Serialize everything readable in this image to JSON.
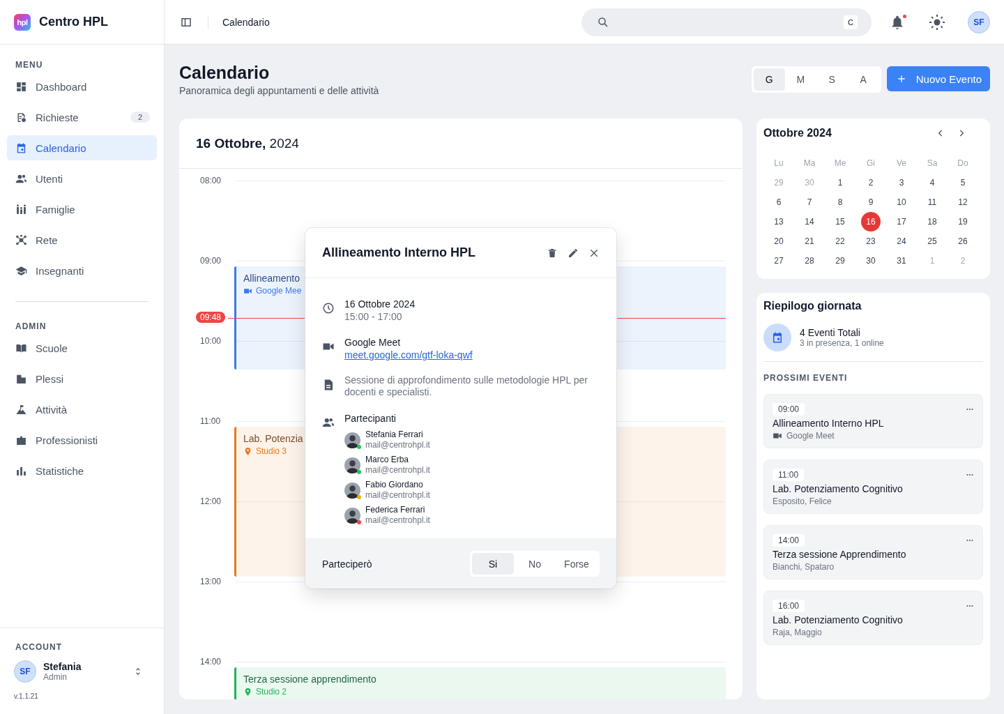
{
  "brand": {
    "logo_text": "hpl",
    "name": "Centro HPL"
  },
  "sidebar": {
    "sections": [
      {
        "title": "MENU",
        "items": [
          {
            "label": "Dashboard",
            "selected": false
          },
          {
            "label": "Richieste",
            "badge": "2",
            "selected": false
          },
          {
            "label": "Calendario",
            "selected": true
          },
          {
            "label": "Utenti",
            "selected": false
          },
          {
            "label": "Famiglie",
            "selected": false
          },
          {
            "label": "Rete",
            "selected": false
          },
          {
            "label": "Insegnanti",
            "selected": false
          }
        ]
      },
      {
        "title": "ADMIN",
        "items": [
          {
            "label": "Scuole",
            "selected": false
          },
          {
            "label": "Plessi",
            "selected": false
          },
          {
            "label": "Attività",
            "selected": false
          },
          {
            "label": "Professionisti",
            "selected": false
          },
          {
            "label": "Statistiche",
            "selected": false
          }
        ]
      }
    ],
    "account": {
      "title": "ACCOUNT",
      "initials": "SF",
      "name": "Stefania",
      "role": "Admin"
    },
    "version": "v.1.1.21"
  },
  "header": {
    "breadcrumb": "Calendario",
    "search": {
      "shortcut": "C"
    },
    "notifications": {
      "unread": true
    },
    "user_initials": "SF"
  },
  "page": {
    "title": "Calendario",
    "subtitle": "Panoramica degli appuntamenti e delle attività",
    "view_tabs": [
      {
        "label": "G",
        "selected": true
      },
      {
        "label": "M",
        "selected": false
      },
      {
        "label": "S",
        "selected": false
      },
      {
        "label": "A",
        "selected": false
      }
    ],
    "new_button": "Nuovo Evento"
  },
  "day_view": {
    "date": "**16 Ottobre,** 2024",
    "hours": [
      "08:00",
      "09:00",
      "10:00",
      "11:00",
      "12:00",
      "13:00",
      "14:00"
    ],
    "now": {
      "label": "09:48"
    },
    "events": [
      {
        "kind": "online",
        "title": "Allineamento",
        "location": "Google Mee",
        "color": "#3b7ae8"
      },
      {
        "kind": "in_person",
        "title": "Lab. Potenzia",
        "location": "Studio 3",
        "color": "#ea7a1a"
      },
      {
        "kind": "in_person",
        "title": "Terza sessione apprendimento",
        "location": "Studio 2",
        "color": "#22b35b"
      }
    ]
  },
  "event_popover": {
    "title": "Allineamento Interno HPL",
    "date": "16 Ottobre 2024",
    "time": "15:00 - 17:00",
    "platform": "Google Meet",
    "link": "meet.google.com/gtf-loka-qwf",
    "description": "Sessione di approfondimento sulle metodologie HPL per docenti e specialisti.",
    "participants_title": "Partecipanti",
    "participants": [
      {
        "name": "Stefania Ferrari",
        "email": "mail@centrohpl.it",
        "color": "#22c55e"
      },
      {
        "name": "Marco Erba",
        "email": "mail@centrohpl.it",
        "color": "#22c55e"
      },
      {
        "name": "Fabio Giordano",
        "email": "mail@centrohpl.it",
        "color": "#eab308"
      },
      {
        "name": "Federica Ferrari",
        "email": "mail@centrohpl.it",
        "color": "#ef4444"
      }
    ],
    "rsvp_label": "Parteciperò",
    "rsvp_options": [
      {
        "label": "Si",
        "selected": true
      },
      {
        "label": "No",
        "selected": false
      },
      {
        "label": "Forse",
        "selected": false
      }
    ]
  },
  "mini_calendar": {
    "title": "Ottobre 2024",
    "weekdays": [
      "Lu",
      "Ma",
      "Me",
      "Gi",
      "Ve",
      "Sa",
      "Do"
    ],
    "weeks": [
      [
        {
          "day": "29",
          "muted": true,
          "selected": false
        },
        {
          "day": "30",
          "muted": true,
          "selected": false
        },
        {
          "day": "1",
          "muted": false,
          "selected": false
        },
        {
          "day": "2",
          "muted": false,
          "selected": false
        },
        {
          "day": "3",
          "muted": false,
          "selected": false
        },
        {
          "day": "4",
          "muted": false,
          "selected": false
        },
        {
          "day": "5",
          "muted": false,
          "selected": false
        }
      ],
      [
        {
          "day": "6",
          "muted": false,
          "selected": false
        },
        {
          "day": "7",
          "muted": false,
          "selected": false
        },
        {
          "day": "8",
          "muted": false,
          "selected": false
        },
        {
          "day": "9",
          "muted": false,
          "selected": false
        },
        {
          "day": "10",
          "muted": false,
          "selected": false
        },
        {
          "day": "11",
          "muted": false,
          "selected": false
        },
        {
          "day": "12",
          "muted": false,
          "selected": false
        }
      ],
      [
        {
          "day": "13",
          "muted": false,
          "selected": false
        },
        {
          "day": "14",
          "muted": false,
          "selected": false
        },
        {
          "day": "15",
          "muted": false,
          "selected": false
        },
        {
          "day": "16",
          "muted": false,
          "selected": true
        },
        {
          "day": "17",
          "muted": false,
          "selected": false
        },
        {
          "day": "18",
          "muted": false,
          "selected": false
        },
        {
          "day": "19",
          "muted": false,
          "selected": false
        }
      ],
      [
        {
          "day": "20",
          "muted": false,
          "selected": false
        },
        {
          "day": "21",
          "muted": false,
          "selected": false
        },
        {
          "day": "22",
          "muted": false,
          "selected": false
        },
        {
          "day": "23",
          "muted": false,
          "selected": false
        },
        {
          "day": "24",
          "muted": false,
          "selected": false
        },
        {
          "day": "25",
          "muted": false,
          "selected": false
        },
        {
          "day": "26",
          "muted": false,
          "selected": false
        }
      ],
      [
        {
          "day": "27",
          "muted": false,
          "selected": false
        },
        {
          "day": "28",
          "muted": false,
          "selected": false
        },
        {
          "day": "29",
          "muted": false,
          "selected": false
        },
        {
          "day": "30",
          "muted": false,
          "selected": false
        },
        {
          "day": "31",
          "muted": false,
          "selected": false
        },
        {
          "day": "1",
          "muted": true,
          "selected": false
        },
        {
          "day": "2",
          "muted": true,
          "selected": false
        }
      ]
    ]
  },
  "summary": {
    "title": "Riepilogo giornata",
    "total": "4 Eventi Totali",
    "breakdown": "3 in presenza, 1 online",
    "upcoming_title": "PROSSIMI EVENTI",
    "upcoming": [
      {
        "kind": "online",
        "time": "09:00",
        "title": "Allineamento Interno HPL",
        "detail": "Google Meet"
      },
      {
        "kind": "people",
        "time": "11:00",
        "title": "Lab. Potenziamento Cognitivo",
        "detail": "Esposito, Felice"
      },
      {
        "kind": "people",
        "time": "14:00",
        "title": "Terza sessione Apprendimento",
        "detail": "Bianchi, Spataro"
      },
      {
        "kind": "people",
        "time": "16:00",
        "title": "Lab. Potenziamento Cognitivo",
        "detail": "Raja, Maggio"
      }
    ]
  }
}
